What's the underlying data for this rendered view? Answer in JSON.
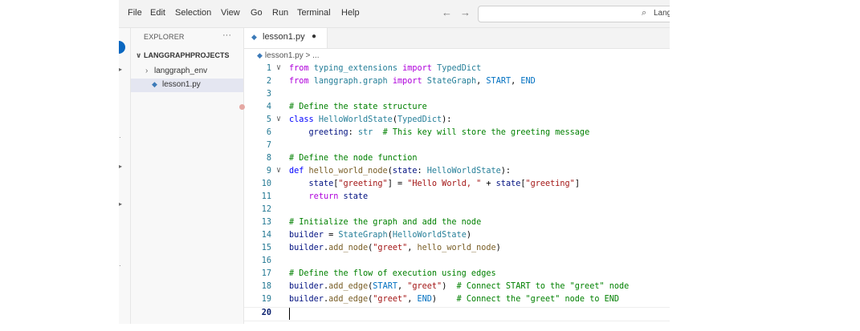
{
  "menu": [
    "File",
    "Edit",
    "Selection",
    "View",
    "Go",
    "Run",
    "Terminal",
    "Help"
  ],
  "nav": {
    "back": "←",
    "forward": "→"
  },
  "command_center": {
    "text": "Lang"
  },
  "sidebar": {
    "title": "EXPLORER",
    "more": "···",
    "project": "LANGGRAPHPROJECTS",
    "folder": "langgraph_env",
    "file": "lesson1.py"
  },
  "tab": {
    "label": "lesson1.py",
    "modified": "●"
  },
  "breadcrumb": {
    "file": "lesson1.py",
    "rest": " > ..."
  },
  "editor": {
    "breakpoint_line": 4,
    "current_line": 20,
    "foldable_lines": [
      1,
      5,
      9
    ],
    "lines": [
      [
        [
          "kw",
          "from"
        ],
        [
          "plain",
          " "
        ],
        [
          "mod",
          "typing_extensions"
        ],
        [
          "plain",
          " "
        ],
        [
          "kw",
          "import"
        ],
        [
          "plain",
          " "
        ],
        [
          "cls",
          "TypedDict"
        ]
      ],
      [
        [
          "kw",
          "from"
        ],
        [
          "plain",
          " "
        ],
        [
          "mod",
          "langgraph.graph"
        ],
        [
          "plain",
          " "
        ],
        [
          "kw",
          "import"
        ],
        [
          "plain",
          " "
        ],
        [
          "cls",
          "StateGraph"
        ],
        [
          "plain",
          ", "
        ],
        [
          "const",
          "START"
        ],
        [
          "plain",
          ", "
        ],
        [
          "const",
          "END"
        ]
      ],
      [],
      [
        [
          "cmt",
          "# Define the state structure"
        ]
      ],
      [
        [
          "kw2",
          "class"
        ],
        [
          "plain",
          " "
        ],
        [
          "cls",
          "HelloWorldState"
        ],
        [
          "plain",
          "("
        ],
        [
          "cls",
          "TypedDict"
        ],
        [
          "plain",
          "):"
        ]
      ],
      [
        [
          "plain",
          "    "
        ],
        [
          "var",
          "greeting"
        ],
        [
          "plain",
          ": "
        ],
        [
          "cls",
          "str"
        ],
        [
          "plain",
          "  "
        ],
        [
          "cmt",
          "# This key will store the greeting message"
        ]
      ],
      [],
      [
        [
          "cmt",
          "# Define the node function"
        ]
      ],
      [
        [
          "kw2",
          "def"
        ],
        [
          "plain",
          " "
        ],
        [
          "fn",
          "hello_world_node"
        ],
        [
          "plain",
          "("
        ],
        [
          "param",
          "state"
        ],
        [
          "plain",
          ": "
        ],
        [
          "cls",
          "HelloWorldState"
        ],
        [
          "plain",
          "):"
        ]
      ],
      [
        [
          "plain",
          "    "
        ],
        [
          "var",
          "state"
        ],
        [
          "plain",
          "["
        ],
        [
          "str",
          "\"greeting\""
        ],
        [
          "plain",
          "] = "
        ],
        [
          "str",
          "\"Hello World, \""
        ],
        [
          "plain",
          " + "
        ],
        [
          "var",
          "state"
        ],
        [
          "plain",
          "["
        ],
        [
          "str",
          "\"greeting\""
        ],
        [
          "plain",
          "]"
        ]
      ],
      [
        [
          "plain",
          "    "
        ],
        [
          "kw",
          "return"
        ],
        [
          "plain",
          " "
        ],
        [
          "var",
          "state"
        ]
      ],
      [],
      [
        [
          "cmt",
          "# Initialize the graph and add the node"
        ]
      ],
      [
        [
          "var",
          "builder"
        ],
        [
          "plain",
          " = "
        ],
        [
          "cls",
          "StateGraph"
        ],
        [
          "plain",
          "("
        ],
        [
          "cls",
          "HelloWorldState"
        ],
        [
          "plain",
          ")"
        ]
      ],
      [
        [
          "var",
          "builder"
        ],
        [
          "plain",
          "."
        ],
        [
          "fn",
          "add_node"
        ],
        [
          "plain",
          "("
        ],
        [
          "str",
          "\"greet\""
        ],
        [
          "plain",
          ", "
        ],
        [
          "fn",
          "hello_world_node"
        ],
        [
          "plain",
          ")"
        ]
      ],
      [],
      [
        [
          "cmt",
          "# Define the flow of execution using edges"
        ]
      ],
      [
        [
          "var",
          "builder"
        ],
        [
          "plain",
          "."
        ],
        [
          "fn",
          "add_edge"
        ],
        [
          "plain",
          "("
        ],
        [
          "const",
          "START"
        ],
        [
          "plain",
          ", "
        ],
        [
          "str",
          "\"greet\""
        ],
        [
          "plain",
          ")  "
        ],
        [
          "cmt",
          "# Connect START to the \"greet\" node"
        ]
      ],
      [
        [
          "var",
          "builder"
        ],
        [
          "plain",
          "."
        ],
        [
          "fn",
          "add_edge"
        ],
        [
          "plain",
          "("
        ],
        [
          "str",
          "\"greet\""
        ],
        [
          "plain",
          ", "
        ],
        [
          "const",
          "END"
        ],
        [
          "plain",
          ")    "
        ],
        [
          "cmt",
          "# Connect the \"greet\" node to END"
        ]
      ],
      []
    ]
  }
}
